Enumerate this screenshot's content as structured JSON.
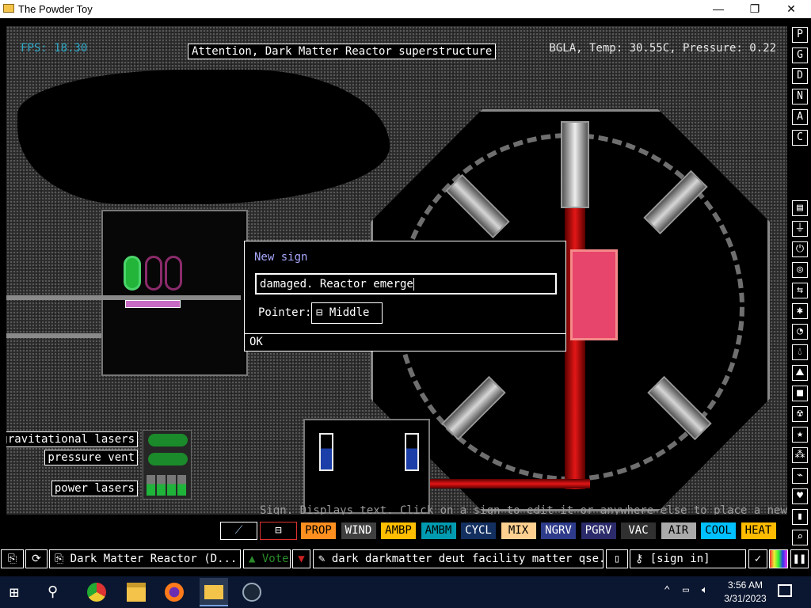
{
  "window": {
    "title": "The Powder Toy",
    "minimize": "—",
    "maximize": "❐",
    "close": "✕"
  },
  "hud": {
    "fps": "FPS: 18.30",
    "hover_info": "BGLA, Temp: 30.55C, Pressure: 0.22"
  },
  "signs": {
    "attention": "Attention, Dark Matter Reactor superstructure",
    "gravitational_lasers": "gravitational lasers",
    "pressure_vent": "pressure vent",
    "power_lasers": "power lasers"
  },
  "dialog": {
    "title": "New sign",
    "input_value": "damaged. Reactor emerge",
    "pointer_label": "Pointer:",
    "pointer_value": "Middle",
    "ok_label": "OK"
  },
  "status_text": "Sign. Displays text. Click on a sign to edit it or anywhere else to place a new one.",
  "right_toolbar": {
    "render_modes": [
      "P",
      "G",
      "D",
      "N",
      "A",
      "C"
    ],
    "categories": [
      "wall-icon",
      "electronics-icon",
      "powered-icon",
      "sensor-icon",
      "force-icon",
      "explosives-icon",
      "gas-icon",
      "liquid-icon",
      "powder-icon",
      "solid-icon",
      "radioactive-icon",
      "special-icon",
      "life-icon",
      "tools-icon",
      "favorites-icon",
      "decoration-icon",
      "search-icon"
    ]
  },
  "element_bar": [
    {
      "label": "PROP",
      "bg": "#ff9020",
      "fg": "#000000"
    },
    {
      "label": "WIND",
      "bg": "#404040",
      "fg": "#ffffff"
    },
    {
      "label": "AMBP",
      "bg": "#ffbf00",
      "fg": "#000000"
    },
    {
      "label": "AMBM",
      "bg": "#009bb0",
      "fg": "#000000"
    },
    {
      "label": "CYCL",
      "bg": "#132f60",
      "fg": "#ffffff"
    },
    {
      "label": "MIX",
      "bg": "#ffd090",
      "fg": "#000000"
    },
    {
      "label": "NGRV",
      "bg": "#2e3b8a",
      "fg": "#ffffff"
    },
    {
      "label": "PGRV",
      "bg": "#2b2b6b",
      "fg": "#ffffff"
    },
    {
      "label": "VAC",
      "bg": "#303030",
      "fg": "#ffffff"
    },
    {
      "label": "AIR",
      "bg": "#aaaaaa",
      "fg": "#000000"
    },
    {
      "label": "COOL",
      "bg": "#00c0ff",
      "fg": "#000000"
    },
    {
      "label": "HEAT",
      "bg": "#ffbb00",
      "fg": "#000000"
    }
  ],
  "bottom_bar": {
    "save_name": "Dark Matter Reactor (D...",
    "vote_label": "Vote",
    "tags": "dark darkmatter deut facility matter qse...",
    "login": "[sign in]"
  },
  "taskbar": {
    "time": "3:56 AM",
    "date": "3/31/2023"
  }
}
